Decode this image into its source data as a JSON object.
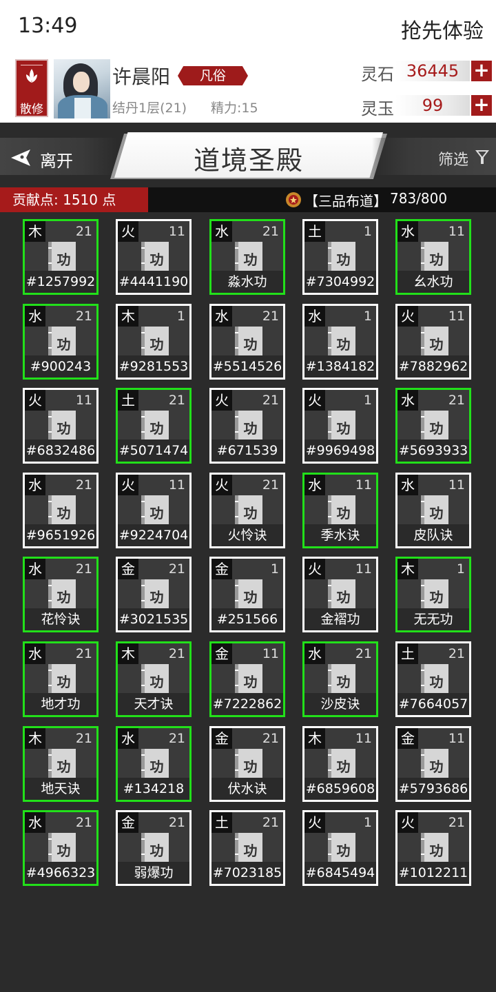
{
  "status_bar": {
    "time": "13:49",
    "right_text": "抢先体验"
  },
  "profile": {
    "sect_label": "散修",
    "player_name": "许晨阳",
    "rank": "凡俗",
    "cultivation": "结丹1层(21)",
    "stamina": "精力:15",
    "resources": [
      {
        "label": "灵石",
        "value": "36445"
      },
      {
        "label": "灵玉",
        "value": "99"
      }
    ]
  },
  "nav": {
    "leave_label": "离开",
    "title": "道境圣殿",
    "filter_label": "筛选"
  },
  "contribution": {
    "points_text": "贡献点: 1510 点",
    "tier_label": "【三品布道】",
    "tier_progress": "783/800"
  },
  "book_glyph": "功",
  "colors": {
    "accent_red": "#a61b1b",
    "green_border": "#22e01a",
    "white_border": "#ffffff"
  },
  "cards": [
    {
      "elem": "木",
      "lvl": "21",
      "name": "#1257992",
      "green": true
    },
    {
      "elem": "火",
      "lvl": "11",
      "name": "#4441190",
      "green": false
    },
    {
      "elem": "水",
      "lvl": "21",
      "name": "淼水功",
      "green": true
    },
    {
      "elem": "土",
      "lvl": "1",
      "name": "#7304992",
      "green": false
    },
    {
      "elem": "水",
      "lvl": "11",
      "name": "幺水功",
      "green": true
    },
    {
      "elem": "水",
      "lvl": "21",
      "name": "#900243",
      "green": true
    },
    {
      "elem": "木",
      "lvl": "1",
      "name": "#9281553",
      "green": false
    },
    {
      "elem": "水",
      "lvl": "21",
      "name": "#5514526",
      "green": false
    },
    {
      "elem": "水",
      "lvl": "1",
      "name": "#1384182",
      "green": false
    },
    {
      "elem": "火",
      "lvl": "11",
      "name": "#7882962",
      "green": false
    },
    {
      "elem": "火",
      "lvl": "11",
      "name": "#6832486",
      "green": false
    },
    {
      "elem": "土",
      "lvl": "21",
      "name": "#5071474",
      "green": true
    },
    {
      "elem": "火",
      "lvl": "21",
      "name": "#671539",
      "green": false
    },
    {
      "elem": "火",
      "lvl": "1",
      "name": "#9969498",
      "green": false
    },
    {
      "elem": "水",
      "lvl": "21",
      "name": "#5693933",
      "green": true
    },
    {
      "elem": "水",
      "lvl": "21",
      "name": "#9651926",
      "green": false
    },
    {
      "elem": "火",
      "lvl": "11",
      "name": "#9224704",
      "green": false
    },
    {
      "elem": "火",
      "lvl": "21",
      "name": "火怜诀",
      "green": false
    },
    {
      "elem": "水",
      "lvl": "11",
      "name": "季水诀",
      "green": true
    },
    {
      "elem": "水",
      "lvl": "11",
      "name": "皮队诀",
      "green": false
    },
    {
      "elem": "水",
      "lvl": "21",
      "name": "花怜诀",
      "green": true
    },
    {
      "elem": "金",
      "lvl": "21",
      "name": "#3021535",
      "green": false
    },
    {
      "elem": "金",
      "lvl": "1",
      "name": "#251566",
      "green": false
    },
    {
      "elem": "火",
      "lvl": "11",
      "name": "金褶功",
      "green": false
    },
    {
      "elem": "木",
      "lvl": "1",
      "name": "无无功",
      "green": true
    },
    {
      "elem": "水",
      "lvl": "21",
      "name": "地才功",
      "green": true
    },
    {
      "elem": "木",
      "lvl": "21",
      "name": "天才诀",
      "green": true
    },
    {
      "elem": "金",
      "lvl": "11",
      "name": "#7222862",
      "green": true
    },
    {
      "elem": "水",
      "lvl": "21",
      "name": "沙皮诀",
      "green": true
    },
    {
      "elem": "土",
      "lvl": "21",
      "name": "#7664057",
      "green": false
    },
    {
      "elem": "木",
      "lvl": "21",
      "name": "地天诀",
      "green": true
    },
    {
      "elem": "水",
      "lvl": "21",
      "name": "#134218",
      "green": true
    },
    {
      "elem": "金",
      "lvl": "21",
      "name": "伏水诀",
      "green": false
    },
    {
      "elem": "木",
      "lvl": "11",
      "name": "#6859608",
      "green": false
    },
    {
      "elem": "金",
      "lvl": "11",
      "name": "#5793686",
      "green": false
    },
    {
      "elem": "水",
      "lvl": "21",
      "name": "#4966323",
      "green": true
    },
    {
      "elem": "金",
      "lvl": "21",
      "name": "弱爆功",
      "green": false
    },
    {
      "elem": "土",
      "lvl": "21",
      "name": "#7023185",
      "green": false
    },
    {
      "elem": "火",
      "lvl": "1",
      "name": "#6845494",
      "green": false
    },
    {
      "elem": "火",
      "lvl": "21",
      "name": "#1012211",
      "green": false
    }
  ]
}
